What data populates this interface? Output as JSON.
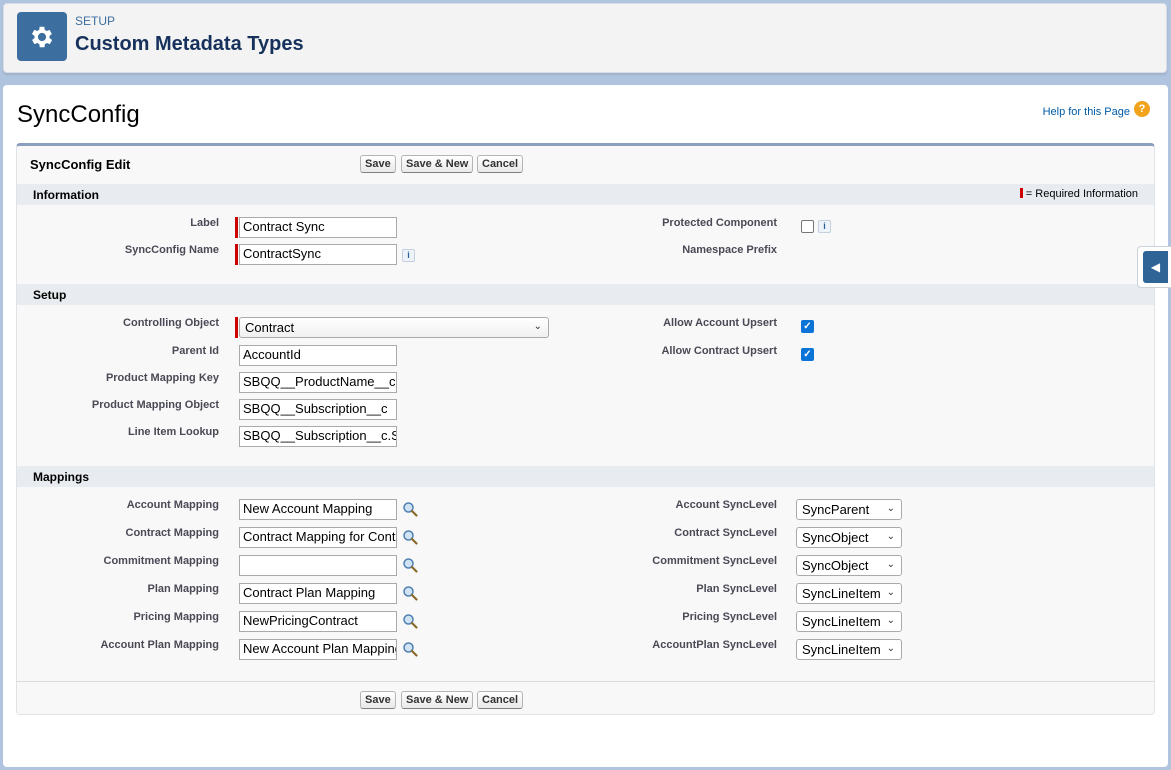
{
  "header": {
    "eyebrow": "SETUP",
    "title": "Custom Metadata Types",
    "icon": "gear-icon"
  },
  "record_title": "SyncConfig",
  "help": {
    "link_text": "Help for this Page",
    "icon_glyph": "?"
  },
  "edit_block": {
    "title": "SyncConfig Edit",
    "buttons": {
      "save": "Save",
      "save_new": "Save & New",
      "cancel": "Cancel"
    }
  },
  "required_legend": "= Required Information",
  "sections": {
    "information": {
      "title": "Information",
      "label_label": "Label",
      "label_value": "Contract Sync",
      "name_label": "SyncConfig Name",
      "name_value": "ContractSync",
      "protected_label": "Protected Component",
      "protected_checked": false,
      "namespace_label": "Namespace Prefix",
      "namespace_value": ""
    },
    "setup": {
      "title": "Setup",
      "controlling_object_label": "Controlling Object",
      "controlling_object_value": "Contract",
      "parent_id_label": "Parent Id",
      "parent_id_value": "AccountId",
      "product_mapping_key_label": "Product Mapping Key",
      "product_mapping_key_value": "SBQQ__ProductName__c",
      "product_mapping_object_label": "Product Mapping Object",
      "product_mapping_object_value": "SBQQ__Subscription__c",
      "line_item_lookup_label": "Line Item Lookup",
      "line_item_lookup_value": "SBQQ__Subscription__c.S",
      "allow_account_upsert_label": "Allow Account Upsert",
      "allow_account_upsert_checked": true,
      "allow_contract_upsert_label": "Allow Contract Upsert",
      "allow_contract_upsert_checked": true
    },
    "mappings": {
      "title": "Mappings",
      "rows": [
        {
          "label": "Account Mapping",
          "value": "New Account Mapping",
          "sync_label": "Account SyncLevel",
          "sync_value": "SyncParent"
        },
        {
          "label": "Contract Mapping",
          "value": "Contract Mapping for Cont",
          "sync_label": "Contract SyncLevel",
          "sync_value": "SyncObject"
        },
        {
          "label": "Commitment Mapping",
          "value": "",
          "sync_label": "Commitment SyncLevel",
          "sync_value": "SyncObject"
        },
        {
          "label": "Plan Mapping",
          "value": "Contract Plan Mapping",
          "sync_label": "Plan SyncLevel",
          "sync_value": "SyncLineItem"
        },
        {
          "label": "Pricing Mapping",
          "value": "NewPricingContract",
          "sync_label": "Pricing SyncLevel",
          "sync_value": "SyncLineItem"
        },
        {
          "label": "Account Plan Mapping",
          "value": "New Account Plan Mapping",
          "sync_label": "AccountPlan SyncLevel",
          "sync_value": "SyncLineItem"
        }
      ]
    }
  },
  "colors": {
    "brand": "#3c6f9f",
    "required": "#cc0000",
    "checkbox": "#0b74d6",
    "link": "#015ba7"
  }
}
